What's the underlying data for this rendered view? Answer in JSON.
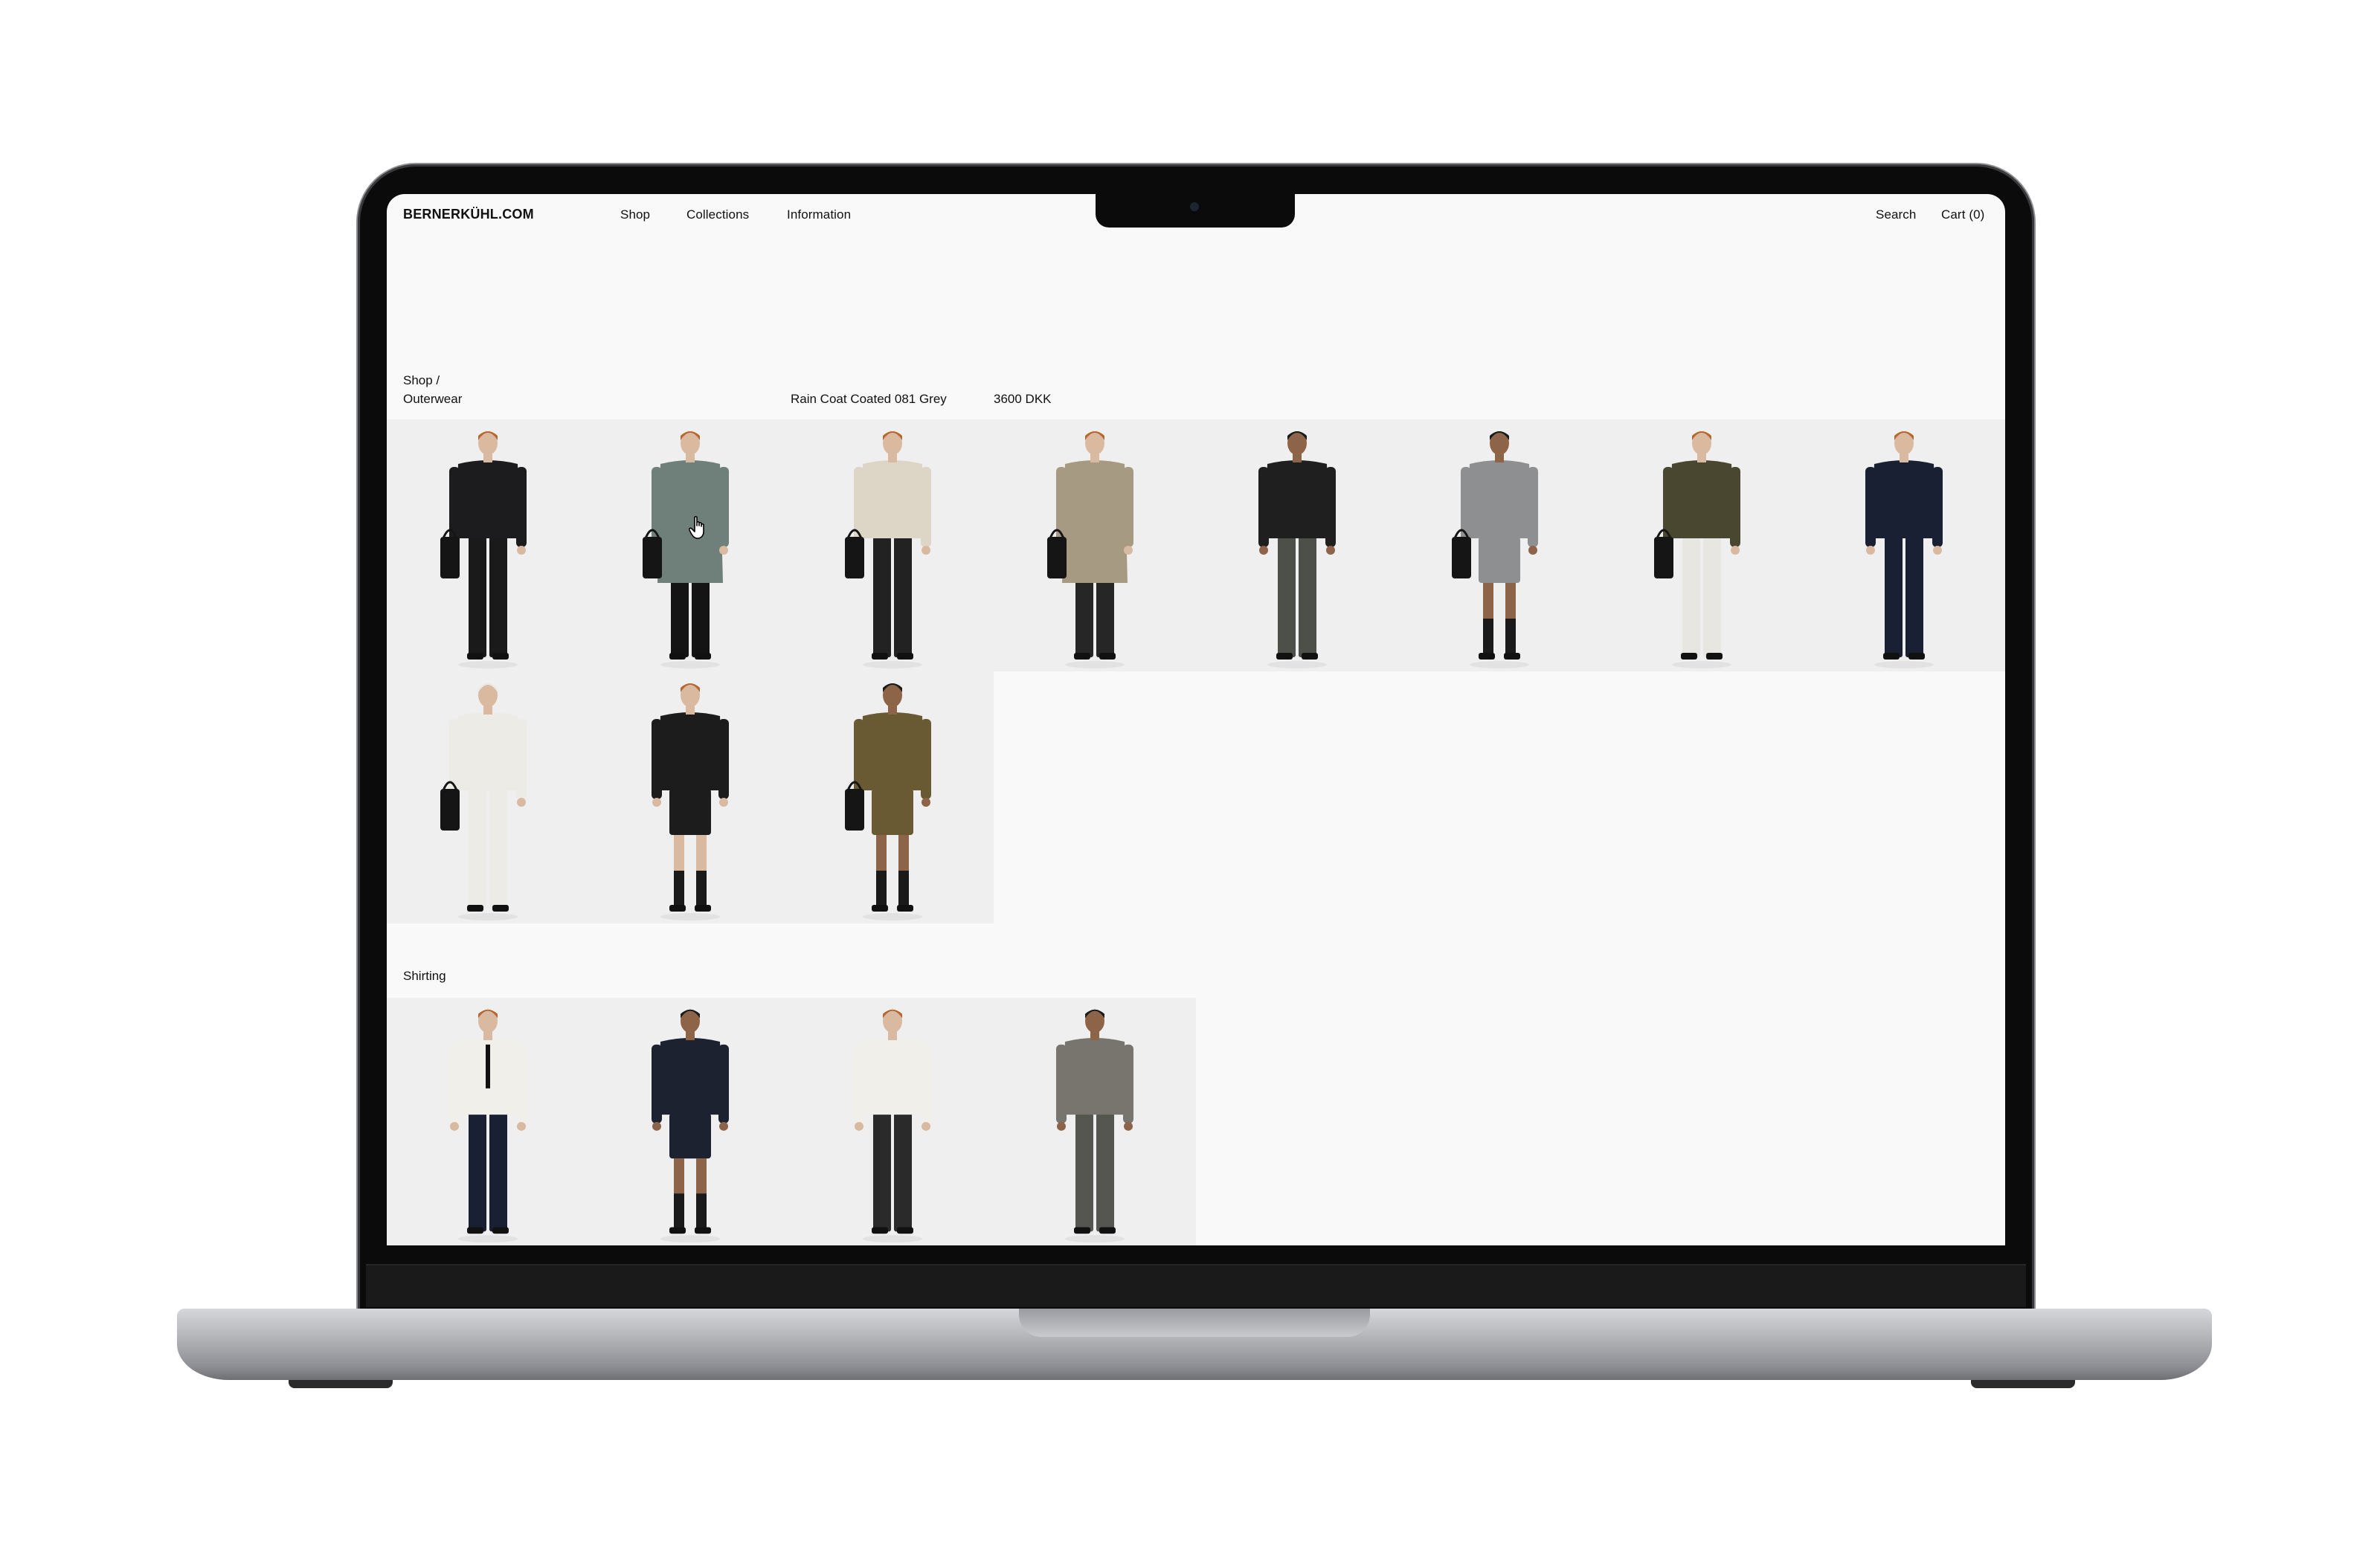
{
  "site": {
    "logo": "BERNERKÜHL.COM",
    "nav": {
      "shop": "Shop",
      "collections": "Collections",
      "information": "Information"
    },
    "search": "Search",
    "cart": "Cart (0)"
  },
  "breadcrumb": {
    "root": "Shop /",
    "category": "Outerwear"
  },
  "hover_product": {
    "name": "Rain Coat Coated 081 Grey",
    "price": "3600 DKK"
  },
  "sections": {
    "shirting_title": "Shirting"
  },
  "products": {
    "outerwear": [
      {
        "top": "#1c1c1e",
        "bottom": "#1a1a1a",
        "skin": "#d9b9a0",
        "hair": "#b8672e",
        "bag": true,
        "coat": false,
        "shorts": false
      },
      {
        "top": "#6f7f79",
        "bottom": "#141414",
        "skin": "#d9b9a0",
        "hair": "#b8672e",
        "bag": true,
        "coat": true,
        "shorts": false,
        "profile": true
      },
      {
        "top": "#ddd6c6",
        "bottom": "#222222",
        "skin": "#d9b9a0",
        "hair": "#b8672e",
        "bag": true,
        "coat": false,
        "shorts": false
      },
      {
        "top": "#a79a83",
        "bottom": "#262626",
        "skin": "#d9b9a0",
        "hair": "#b8672e",
        "bag": true,
        "coat": true,
        "shorts": false
      },
      {
        "top": "#1f1f1f",
        "bottom": "#4d4f49",
        "skin": "#8d6448",
        "hair": "#1a1a1a",
        "bag": false,
        "coat": false,
        "shorts": false
      },
      {
        "top": "#8d8f91",
        "bottom": "#8d8f91",
        "skin": "#8d6448",
        "hair": "#1a1a1a",
        "bag": true,
        "coat": false,
        "shorts": true
      },
      {
        "top": "#4a4730",
        "bottom": "#e8e6e1",
        "skin": "#d9b9a0",
        "hair": "#b8672e",
        "bag": true,
        "coat": false,
        "shorts": false
      },
      {
        "top": "#1a2033",
        "bottom": "#1a2033",
        "skin": "#d9b9a0",
        "hair": "#b8672e",
        "bag": false,
        "coat": false,
        "shorts": false
      }
    ],
    "outerwear_row2": [
      {
        "top": "#ecebe6",
        "bottom": "#ecebe6",
        "skin": "#d9b9a0",
        "hair": "#ecebe6",
        "bag": true,
        "coat": false,
        "shorts": false
      },
      {
        "top": "#1c1c1c",
        "bottom": "#1c1c1c",
        "skin": "#d9b9a0",
        "hair": "#b8672e",
        "bag": false,
        "coat": false,
        "shorts": true
      },
      {
        "top": "#6a5a33",
        "bottom": "#6a5a33",
        "skin": "#8d6448",
        "hair": "#1a1a1a",
        "bag": true,
        "coat": false,
        "shorts": true
      }
    ],
    "shirting": [
      {
        "top": "#f1efea",
        "bottom": "#1a2033",
        "skin": "#d9b9a0",
        "hair": "#b8672e",
        "bag": false,
        "coat": false,
        "shorts": false,
        "tie": true
      },
      {
        "top": "#1d2231",
        "bottom": "#1d2231",
        "skin": "#8d6448",
        "hair": "#1a1a1a",
        "bag": false,
        "coat": false,
        "shorts": true
      },
      {
        "top": "#f1efea",
        "bottom": "#2a2a2a",
        "skin": "#d9b9a0",
        "hair": "#b8672e",
        "bag": false,
        "coat": false,
        "shorts": false
      },
      {
        "top": "#77756d",
        "bottom": "#55564f",
        "skin": "#8d6448",
        "hair": "#1a1a1a",
        "bag": false,
        "coat": false,
        "shorts": false
      }
    ]
  },
  "colors": {
    "screen_bg": "#f9f9f9",
    "tile_bg": "#efefef",
    "text": "#111111"
  }
}
